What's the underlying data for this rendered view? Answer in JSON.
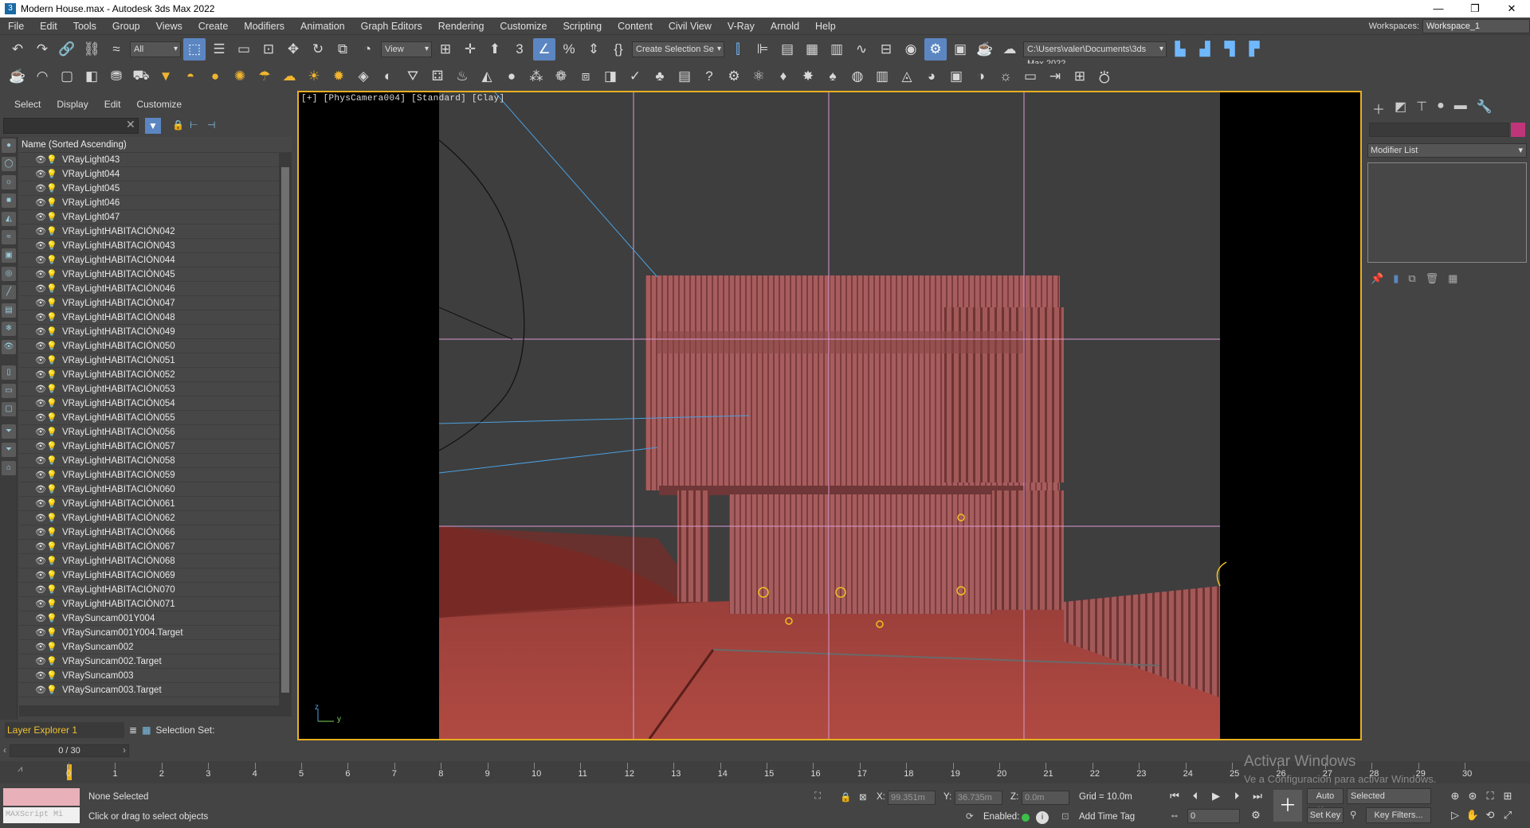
{
  "window": {
    "title": "Modern House.max - Autodesk 3ds Max 2022",
    "minimize": "—",
    "maximize": "❐",
    "close": "✕"
  },
  "menu": [
    "File",
    "Edit",
    "Tools",
    "Group",
    "Views",
    "Create",
    "Modifiers",
    "Animation",
    "Graph Editors",
    "Rendering",
    "Customize",
    "Scripting",
    "Content",
    "Civil View",
    "V-Ray",
    "Arnold",
    "Help"
  ],
  "workspace": {
    "label": "Workspaces:",
    "value": "Workspace_1"
  },
  "toolbar": {
    "filter_value": "All",
    "refcoord_value": "View",
    "selection_set_placeholder": "Create Selection Se",
    "project_path": "C:\\Users\\valer\\Documents\\3ds Max 2022"
  },
  "scene_explorer": {
    "tabs": [
      "Select",
      "Display",
      "Edit",
      "Customize"
    ],
    "column_header": "Name (Sorted Ascending)",
    "rows": [
      "VRayLight043",
      "VRayLight044",
      "VRayLight045",
      "VRayLight046",
      "VRayLight047",
      "VRayLightHABITACIÓN042",
      "VRayLightHABITACIÓN043",
      "VRayLightHABITACIÓN044",
      "VRayLightHABITACIÓN045",
      "VRayLightHABITACIÓN046",
      "VRayLightHABITACIÓN047",
      "VRayLightHABITACIÓN048",
      "VRayLightHABITACIÓN049",
      "VRayLightHABITACIÓN050",
      "VRayLightHABITACIÓN051",
      "VRayLightHABITACIÓN052",
      "VRayLightHABITACIÓN053",
      "VRayLightHABITACIÓN054",
      "VRayLightHABITACIÓN055",
      "VRayLightHABITACIÓN056",
      "VRayLightHABITACIÓN057",
      "VRayLightHABITACIÓN058",
      "VRayLightHABITACIÓN059",
      "VRayLightHABITACIÓN060",
      "VRayLightHABITACIÓN061",
      "VRayLightHABITACIÓN062",
      "VRayLightHABITACIÓN066",
      "VRayLightHABITACIÓN067",
      "VRayLightHABITACIÓN068",
      "VRayLightHABITACIÓN069",
      "VRayLightHABITACIÓN070",
      "VRayLightHABITACIÓN071",
      "VRaySuncam001Y004",
      "VRaySuncam001Y004.Target",
      "VRaySuncam002",
      "VRaySuncam002.Target",
      "VRaySuncam003",
      "VRaySuncam003.Target"
    ],
    "layer_explorer": "Layer Explorer 1",
    "selection_set_label": "Selection Set:"
  },
  "viewport": {
    "label_a": "[+]",
    "label_b": "[PhysCamera004]",
    "label_c": "[Standard]",
    "label_d": "[Clay]",
    "axis_y": "y",
    "axis_z": "z"
  },
  "command_panel": {
    "modifier_list": "Modifier List"
  },
  "timeline": {
    "frame_display": "0 / 30",
    "ticks": [
      "0",
      "1",
      "2",
      "3",
      "4",
      "5",
      "6",
      "7",
      "8",
      "9",
      "10",
      "11",
      "12",
      "13",
      "14",
      "15",
      "16",
      "17",
      "18",
      "19",
      "20",
      "21",
      "22",
      "23",
      "24",
      "25",
      "26",
      "27",
      "28",
      "29",
      "30"
    ]
  },
  "status": {
    "selection": "None Selected",
    "prompt": "Click or drag to select objects",
    "maxscript": "MAXScript Mi",
    "x_label": "X:",
    "x_value": "99.351m",
    "y_label": "Y:",
    "y_value": "36.735m",
    "z_label": "Z:",
    "z_value": "0.0m",
    "grid": "Grid = 10.0m",
    "enabled_label": "Enabled:",
    "add_time_tag": "Add Time Tag",
    "auto_key": "Auto Key",
    "auto_key_mode": "Selected",
    "set_key": "Set Key",
    "key_filters": "Key Filters...",
    "current_frame": "0"
  },
  "watermark": {
    "line1": "Activar Windows",
    "line2": "Ve a Configuración para activar Windows."
  }
}
